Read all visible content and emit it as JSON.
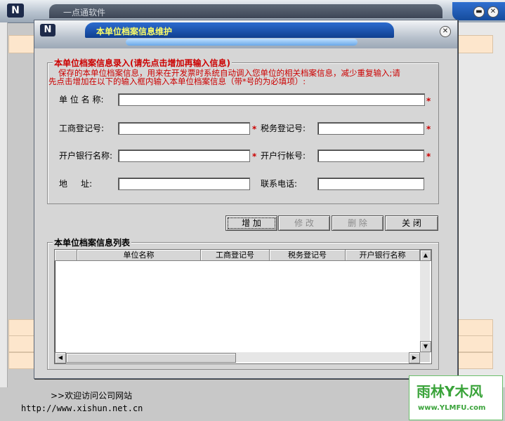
{
  "main_window": {
    "app_title": "一点通软件",
    "welcome_text": ">>欢迎访问公司网站",
    "url_text": "http://www.xishun.net.cn"
  },
  "dialog": {
    "title": "本单位档案信息维护",
    "entry_group": {
      "legend": "本单位档案信息录入(请先点击增加再输入信息)",
      "note_line1": "保存的本单位档案信息，用来在开发票时系统自动调入您单位的相关档案信息，减少重复输入;请",
      "note_line2": "先点击增加在以下的输入框内输入本单位档案信息（带*号的为必填项）:"
    },
    "fields": {
      "company_name": {
        "label": "单 位 名 称:",
        "value": ""
      },
      "business_reg_no": {
        "label": "工商登记号:",
        "value": ""
      },
      "tax_reg_no": {
        "label": "税务登记号:",
        "value": ""
      },
      "bank_name": {
        "label": "开户银行名称:",
        "value": ""
      },
      "bank_account": {
        "label": "开户行帐号:",
        "value": ""
      },
      "address": {
        "label": "地     址:",
        "value": ""
      },
      "phone": {
        "label": "联系电话:",
        "value": ""
      }
    },
    "required_mark": "*",
    "buttons": {
      "add": "增 加",
      "edit": "修 改",
      "delete": "删 除",
      "close": "关 闭"
    },
    "list_group": {
      "legend": "本单位档案信息列表",
      "columns": [
        "",
        "单位名称",
        "工商登记号",
        "税务登记号",
        "开户银行名称"
      ],
      "rows": []
    }
  },
  "watermark": {
    "line1": "雨林Y木风",
    "line2": "www.YLMFU.com"
  }
}
